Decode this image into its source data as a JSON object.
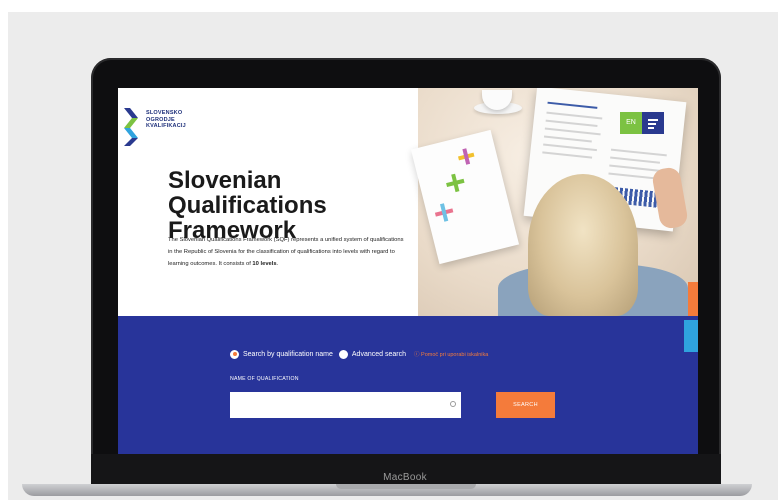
{
  "device": {
    "brand": "MacBook"
  },
  "site": {
    "logo_text": "SLOVENSKO\nOGRODJE\nKVALIFIKACIJ",
    "language_label": "EN",
    "menu_icon": "hamburger-icon"
  },
  "hero": {
    "title": "Slovenian Qualifications Framework",
    "description_main": "The Slovenian Qualifications Framework (SQF) represents a unified system of qualifications in the Republic of Slovenia for the classification of qualifications into levels with regard to learning outcomes. It consists of ",
    "description_bold": "10 levels",
    "description_end": "."
  },
  "search": {
    "option_name_label": "Search by qualification name",
    "option_advanced_label": "Advanced search",
    "help_link_label": "Pomoč pri uporabi iskalnika",
    "field_label": "NAME OF QUALIFICATION",
    "input_value": "",
    "input_placeholder": "",
    "button_label": "SEARCH",
    "selected_option": "Search by qualification name"
  },
  "colors": {
    "brand_blue": "#28349a",
    "accent_orange": "#f47b3b",
    "accent_green": "#7cc242",
    "accent_light_blue": "#2fa3de"
  }
}
